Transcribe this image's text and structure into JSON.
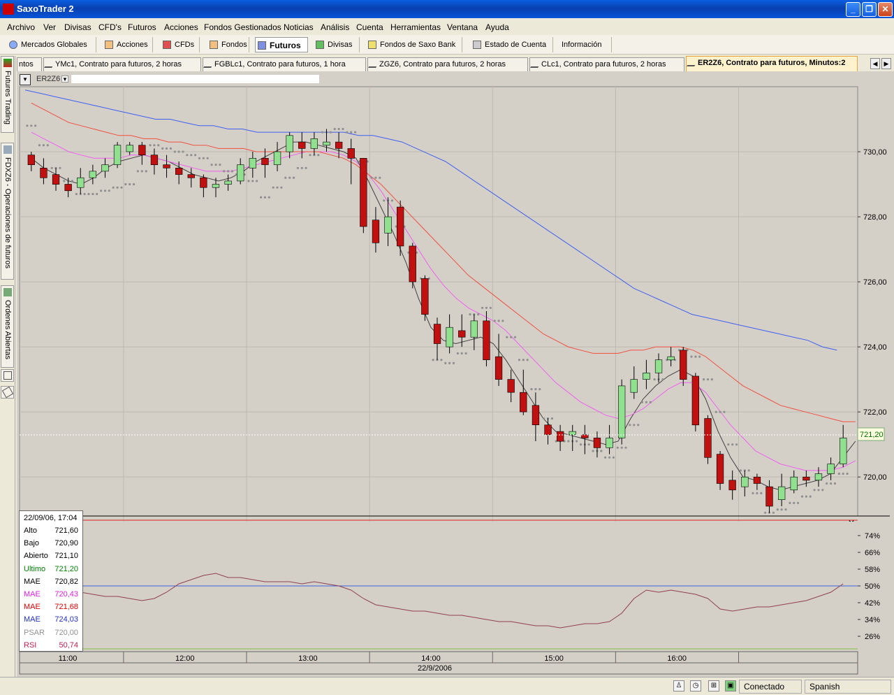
{
  "window": {
    "title": "SaxoTrader 2",
    "min": "_",
    "max": "❐",
    "close": "✕"
  },
  "menu": [
    "Archivo",
    "Ver",
    "Divisas",
    "CFD's",
    "Futuros",
    "Acciones",
    "Fondos Gestionados",
    "Noticias",
    "Análisis",
    "Cuenta",
    "Herramientas",
    "Ventana",
    "Ayuda"
  ],
  "toolbar": [
    "Mercados Globales",
    "Acciones",
    "CFDs",
    "Fondos",
    "Futuros",
    "Divisas",
    "Fondos de Saxo Bank",
    "Estado de Cuenta",
    "Información"
  ],
  "tabs": [
    "ntos",
    "YMc1, Contrato para futuros, 2 horas",
    "FGBLc1, Contrato para futuros, 1 hora",
    "ZGZ6, Contrato para futuros, 2 horas",
    "CLc1, Contrato para futuros, 2 horas",
    "ER2Z6, Contrato para futuros, Minutos:2"
  ],
  "side_tabs": [
    "Futures Trading",
    "FDXZ6 - Operaciones de futuros",
    "Ordenes Abiertas"
  ],
  "chart": {
    "symbol": "ER2Z6",
    "last_price_label": "721,20",
    "date_label": "22/9/2006"
  },
  "info": {
    "datetime": "22/09/06, 17:04",
    "rows": [
      {
        "k": "Alto",
        "v": "721,60",
        "color": "#000000"
      },
      {
        "k": "Bajo",
        "v": "720,90",
        "color": "#000000"
      },
      {
        "k": "Abierto",
        "v": "721,10",
        "color": "#000000"
      },
      {
        "k": "Ultimo",
        "v": "721,20",
        "color": "#008000"
      },
      {
        "k": "MAE",
        "v": "720,82",
        "color": "#000000"
      },
      {
        "k": "MAE",
        "v": "720,43",
        "color": "#E020E0"
      },
      {
        "k": "MAE",
        "v": "721,68",
        "color": "#E00000"
      },
      {
        "k": "MAE",
        "v": "724,03",
        "color": "#2030C0"
      },
      {
        "k": "PSAR",
        "v": "720,00",
        "color": "#909090"
      },
      {
        "k": "RSI",
        "v": "50,74",
        "color": "#C02050"
      }
    ]
  },
  "status": {
    "connection": "Conectado",
    "language": "Spanish"
  },
  "chart_data": {
    "type": "line",
    "x_ticks": [
      "11:00",
      "12:00",
      "13:00",
      "14:00",
      "15:00",
      "16:00"
    ],
    "price_ticks": [
      "730,00",
      "728,00",
      "726,00",
      "724,00",
      "722,00",
      "720,00"
    ],
    "rsi_ticks": [
      "74%",
      "66%",
      "58%",
      "50%",
      "42%",
      "34%",
      "26%"
    ],
    "ylim": [
      718.8,
      732.0
    ],
    "rsi_ylim": [
      20,
      80
    ],
    "colors": {
      "up": "#90E090",
      "down": "#C01010",
      "ma_fast": "#404040",
      "ma_mid": "#F060F0",
      "ma_red": "#F05040",
      "ma_blue": "#4060F0",
      "psar": "#909090",
      "rsi": "#904050"
    },
    "series": [
      {
        "name": "MAE",
        "values": [
          729.8,
          729.5,
          729.3,
          729.1,
          729.0,
          729.2,
          729.5,
          729.7,
          729.8,
          729.9,
          729.8,
          729.7,
          729.5,
          729.3,
          729.2,
          729.1,
          729.2,
          729.4,
          729.7,
          729.9,
          730.1,
          730.3,
          730.3,
          730.2,
          730.1,
          730.0,
          729.8,
          729.1,
          728.3,
          727.5,
          726.6,
          725.5,
          724.6,
          724.2,
          724.1,
          724.2,
          724.3,
          724.1,
          723.6,
          723.0,
          722.4,
          721.8,
          721.4,
          721.3,
          721.2,
          721.1,
          721.0,
          721.1,
          721.8,
          722.4,
          722.8,
          723.1,
          723.3,
          723.1,
          722.4,
          721.4,
          720.6,
          720.0,
          719.9,
          719.7,
          719.6,
          719.7,
          719.8,
          719.9,
          720.1,
          720.6,
          721.1
        ]
      },
      {
        "name": "MAE",
        "values": [
          730.6,
          730.4,
          730.2,
          730.0,
          729.9,
          729.8,
          729.8,
          729.8,
          729.9,
          729.9,
          729.8,
          729.7,
          729.6,
          729.5,
          729.4,
          729.4,
          729.4,
          729.5,
          729.6,
          729.7,
          729.8,
          729.9,
          730.0,
          730.0,
          730.0,
          729.9,
          729.7,
          729.3,
          728.8,
          728.2,
          727.6,
          727.0,
          726.4,
          725.9,
          725.5,
          725.2,
          725.0,
          724.8,
          724.5,
          724.1,
          723.7,
          723.3,
          722.9,
          722.6,
          722.3,
          722.1,
          721.9,
          721.8,
          721.9,
          722.1,
          722.4,
          722.7,
          722.9,
          722.9,
          722.6,
          722.1,
          721.6,
          721.2,
          720.8,
          720.6,
          720.4,
          720.3,
          720.2,
          720.2,
          720.2,
          720.3,
          720.5
        ]
      },
      {
        "name": "MAE",
        "values": [
          731.5,
          731.3,
          731.1,
          730.9,
          730.8,
          730.7,
          730.6,
          730.5,
          730.5,
          730.4,
          730.4,
          730.3,
          730.3,
          730.2,
          730.2,
          730.1,
          730.1,
          730.1,
          730.0,
          730.0,
          730.0,
          730.0,
          730.0,
          730.0,
          729.9,
          729.8,
          729.6,
          729.3,
          729.0,
          728.6,
          728.2,
          727.8,
          727.4,
          727.0,
          726.6,
          726.2,
          725.9,
          725.6,
          725.3,
          725.0,
          724.7,
          724.4,
          724.2,
          724.0,
          723.9,
          723.8,
          723.8,
          723.8,
          723.9,
          723.9,
          724.0,
          724.0,
          724.0,
          723.9,
          723.7,
          723.4,
          723.1,
          722.8,
          722.6,
          722.4,
          722.2,
          722.1,
          722.0,
          721.9,
          721.8,
          721.7,
          721.7
        ]
      },
      {
        "name": "MAE",
        "values": [
          731.9,
          731.8,
          731.7,
          731.6,
          731.5,
          731.4,
          731.3,
          731.2,
          731.1,
          731.0,
          731.0,
          730.9,
          730.8,
          730.8,
          730.7,
          730.7,
          730.6,
          730.6,
          730.6,
          730.6,
          730.6,
          730.6,
          730.6,
          730.5,
          730.5,
          730.4,
          730.3,
          730.1,
          729.9,
          729.7,
          729.4,
          729.1,
          728.8,
          728.5,
          728.2,
          727.9,
          727.6,
          727.3,
          727.0,
          726.7,
          726.4,
          726.1,
          725.8,
          725.6,
          725.4,
          725.2,
          725.0,
          724.9,
          724.8,
          724.7,
          724.6,
          724.5,
          724.4,
          724.3,
          724.2,
          724.0,
          723.9
        ]
      },
      {
        "name": "PSAR",
        "values": [
          730.8,
          730.2,
          729.5,
          729.1,
          728.7,
          728.7,
          728.8,
          728.9,
          729.0,
          729.4,
          730.2,
          730.1,
          730.0,
          729.9,
          729.8,
          729.6,
          729.4,
          729.3,
          729.1,
          728.6,
          728.9,
          729.2,
          729.5,
          729.9,
          730.6,
          730.7,
          730.6,
          729.7,
          729.2,
          728.5,
          727.7,
          726.9,
          726.1,
          723.6,
          723.5,
          723.8,
          725.0,
          725.2,
          724.8,
          724.3,
          723.6,
          722.7,
          721.8,
          721.1,
          721.1,
          721.0,
          720.8,
          720.6,
          720.9,
          721.6,
          722.3,
          723.0,
          723.6,
          723.9,
          723.7,
          723.0,
          722.0,
          721.0,
          720.2,
          719.5,
          718.9,
          719.0,
          719.2,
          719.4,
          719.6,
          719.8,
          720.1
        ]
      },
      {
        "name": "RSI",
        "values": [
          43,
          45,
          47,
          46,
          47,
          46,
          45,
          45,
          44,
          43,
          44,
          47,
          51,
          53,
          55,
          56,
          54,
          54,
          53,
          52,
          52,
          52,
          51,
          52,
          51,
          50,
          48,
          44,
          41,
          40,
          39,
          38,
          38,
          37,
          36,
          36,
          35,
          34,
          33,
          33,
          32,
          31,
          31,
          30,
          31,
          32,
          32,
          33,
          37,
          44,
          48,
          47,
          48,
          47,
          46,
          44,
          39,
          38,
          39,
          40,
          40,
          41,
          42,
          43,
          45,
          47,
          51
        ]
      }
    ],
    "candles": [
      [
        729.9,
        729.6,
        730.0,
        729.4
      ],
      [
        729.5,
        729.2,
        729.8,
        729.0
      ],
      [
        729.3,
        729.0,
        729.5,
        728.8
      ],
      [
        729.0,
        728.8,
        729.2,
        728.6
      ],
      [
        728.9,
        729.2,
        729.5,
        728.7
      ],
      [
        729.2,
        729.4,
        729.6,
        729.0
      ],
      [
        729.4,
        729.6,
        729.8,
        729.2
      ],
      [
        729.6,
        730.2,
        730.3,
        729.5
      ],
      [
        730.0,
        730.2,
        730.3,
        729.9
      ],
      [
        730.2,
        729.9,
        730.3,
        729.6
      ],
      [
        729.9,
        729.6,
        730.1,
        729.3
      ],
      [
        729.6,
        729.5,
        729.9,
        729.2
      ],
      [
        729.5,
        729.3,
        729.7,
        729.0
      ],
      [
        729.3,
        729.2,
        729.5,
        728.9
      ],
      [
        729.2,
        728.9,
        729.3,
        728.6
      ],
      [
        728.9,
        729.0,
        729.2,
        728.6
      ],
      [
        729.0,
        729.1,
        729.3,
        728.8
      ],
      [
        729.1,
        729.6,
        729.8,
        729.0
      ],
      [
        729.5,
        729.8,
        730.0,
        729.2
      ],
      [
        729.8,
        729.6,
        730.1,
        729.2
      ],
      [
        729.6,
        730.0,
        730.3,
        729.4
      ],
      [
        730.0,
        730.5,
        730.6,
        729.8
      ],
      [
        730.3,
        730.1,
        730.6,
        729.8
      ],
      [
        730.1,
        730.4,
        730.6,
        729.9
      ],
      [
        730.2,
        730.3,
        730.7,
        730.0
      ],
      [
        730.3,
        730.1,
        730.6,
        729.8
      ],
      [
        730.1,
        729.8,
        730.4,
        729.0
      ],
      [
        729.8,
        727.7,
        729.5,
        727.5
      ],
      [
        727.9,
        727.2,
        728.3,
        726.9
      ],
      [
        727.5,
        728.0,
        728.6,
        727.1
      ],
      [
        728.3,
        727.1,
        728.5,
        726.8
      ],
      [
        727.1,
        726.0,
        727.2,
        725.8
      ],
      [
        726.1,
        725.0,
        726.2,
        724.8
      ],
      [
        724.7,
        724.1,
        724.9,
        723.6
      ],
      [
        724.0,
        724.6,
        725.0,
        723.8
      ],
      [
        724.5,
        724.3,
        725.0,
        724.0
      ],
      [
        724.3,
        724.8,
        725.0,
        723.9
      ],
      [
        724.8,
        723.6,
        725.1,
        723.4
      ],
      [
        723.7,
        723.0,
        724.4,
        722.8
      ],
      [
        723.0,
        722.6,
        723.3,
        722.3
      ],
      [
        722.6,
        722.0,
        723.3,
        721.9
      ],
      [
        722.2,
        721.6,
        722.6,
        721.1
      ],
      [
        721.6,
        721.3,
        721.8,
        721.0
      ],
      [
        721.4,
        721.1,
        721.6,
        720.8
      ],
      [
        721.3,
        721.4,
        721.6,
        720.8
      ],
      [
        721.3,
        721.2,
        721.6,
        720.7
      ],
      [
        721.2,
        720.9,
        721.4,
        720.6
      ],
      [
        720.9,
        721.2,
        721.6,
        720.7
      ],
      [
        721.2,
        722.8,
        723.0,
        721.0
      ],
      [
        722.6,
        723.0,
        723.4,
        722.4
      ],
      [
        723.0,
        723.2,
        723.6,
        722.7
      ],
      [
        723.2,
        723.6,
        723.8,
        722.9
      ],
      [
        723.6,
        723.7,
        724.0,
        723.4
      ],
      [
        723.9,
        723.0,
        724.0,
        722.8
      ],
      [
        723.1,
        721.6,
        723.2,
        721.4
      ],
      [
        721.8,
        720.6,
        721.9,
        720.4
      ],
      [
        720.7,
        719.8,
        720.8,
        719.6
      ],
      [
        719.9,
        719.6,
        720.2,
        719.3
      ],
      [
        719.7,
        720.0,
        720.2,
        719.4
      ],
      [
        720.0,
        719.8,
        720.1,
        719.6
      ],
      [
        719.7,
        719.1,
        719.9,
        718.9
      ],
      [
        719.3,
        719.7,
        720.1,
        719.1
      ],
      [
        719.6,
        720.0,
        720.2,
        719.5
      ],
      [
        720.0,
        719.9,
        720.2,
        719.7
      ],
      [
        719.9,
        720.1,
        720.3,
        719.7
      ],
      [
        720.1,
        720.4,
        720.6,
        719.9
      ],
      [
        720.4,
        721.2,
        721.6,
        720.3
      ]
    ]
  }
}
